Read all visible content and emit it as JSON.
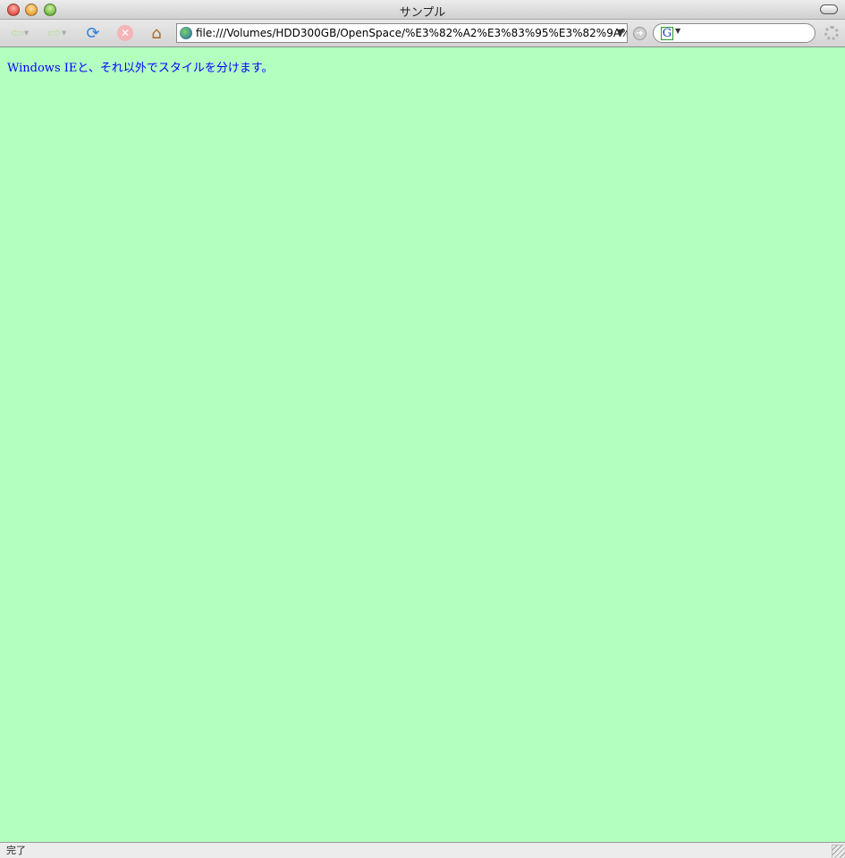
{
  "window": {
    "title": "サンプル"
  },
  "toolbar": {
    "url": "file:///Volumes/HDD300GB/OpenSpace/%E3%82%A2%E3%83%95%E3%82%9A%",
    "search_value": "",
    "search_engine_letter": "G"
  },
  "content": {
    "message": "Windows IEと、それ以外でスタイルを分けます。",
    "background_color": "#b3ffc0",
    "text_color": "#0000ff"
  },
  "status": {
    "text": "完了"
  }
}
